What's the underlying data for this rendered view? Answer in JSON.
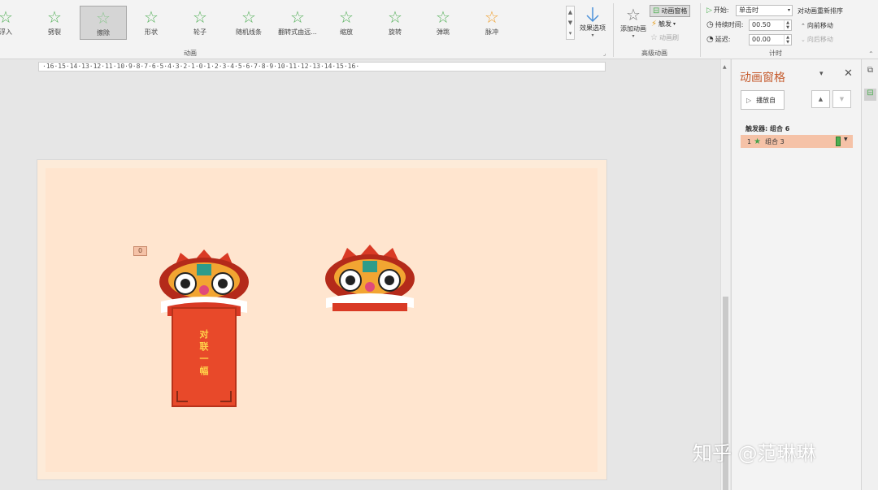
{
  "ribbon": {
    "gallery": [
      {
        "label": "浮入",
        "selected": false,
        "color": "green"
      },
      {
        "label": "劈裂",
        "selected": false,
        "color": "green"
      },
      {
        "label": "擦除",
        "selected": true,
        "color": "green"
      },
      {
        "label": "形状",
        "selected": false,
        "color": "green"
      },
      {
        "label": "轮子",
        "selected": false,
        "color": "green"
      },
      {
        "label": "随机线条",
        "selected": false,
        "color": "green"
      },
      {
        "label": "翻转式由远...",
        "selected": false,
        "color": "green"
      },
      {
        "label": "缩放",
        "selected": false,
        "color": "green"
      },
      {
        "label": "旋转",
        "selected": false,
        "color": "green"
      },
      {
        "label": "弹跳",
        "selected": false,
        "color": "green"
      },
      {
        "label": "脉冲",
        "selected": false,
        "color": "orange"
      }
    ],
    "effect_options": "效果选项",
    "group_animation": "动画",
    "add_animation": "添加动画",
    "animation_pane_btn": "动画窗格",
    "trigger": "触发",
    "animation_painter": "动画刷",
    "group_advanced": "高级动画",
    "start_label": "开始:",
    "start_value": "单击时",
    "duration_label": "持续时间:",
    "duration_value": "00.50",
    "delay_label": "延迟:",
    "delay_value": "00.00",
    "group_timing": "计时",
    "reorder_title": "对动画重新排序",
    "move_earlier": "向前移动",
    "move_later": "向后移动"
  },
  "ruler": {
    "text": "·16·15·14·13·12·11·10·9·8·7·6·5·4·3·2·1·0·1·2·3·4·5·6·7·8·9·10·11·12·13·14·15·16·"
  },
  "slide": {
    "anim_tag": "0",
    "banner_chars": [
      "对",
      "联",
      "一",
      "幅"
    ]
  },
  "pane": {
    "title": "动画窗格",
    "play_from": "播放自",
    "trigger_label": "触发器: 组合 6",
    "item_index": "1",
    "item_name": "组合 3"
  },
  "watermark": "知乎 @范琳琳"
}
